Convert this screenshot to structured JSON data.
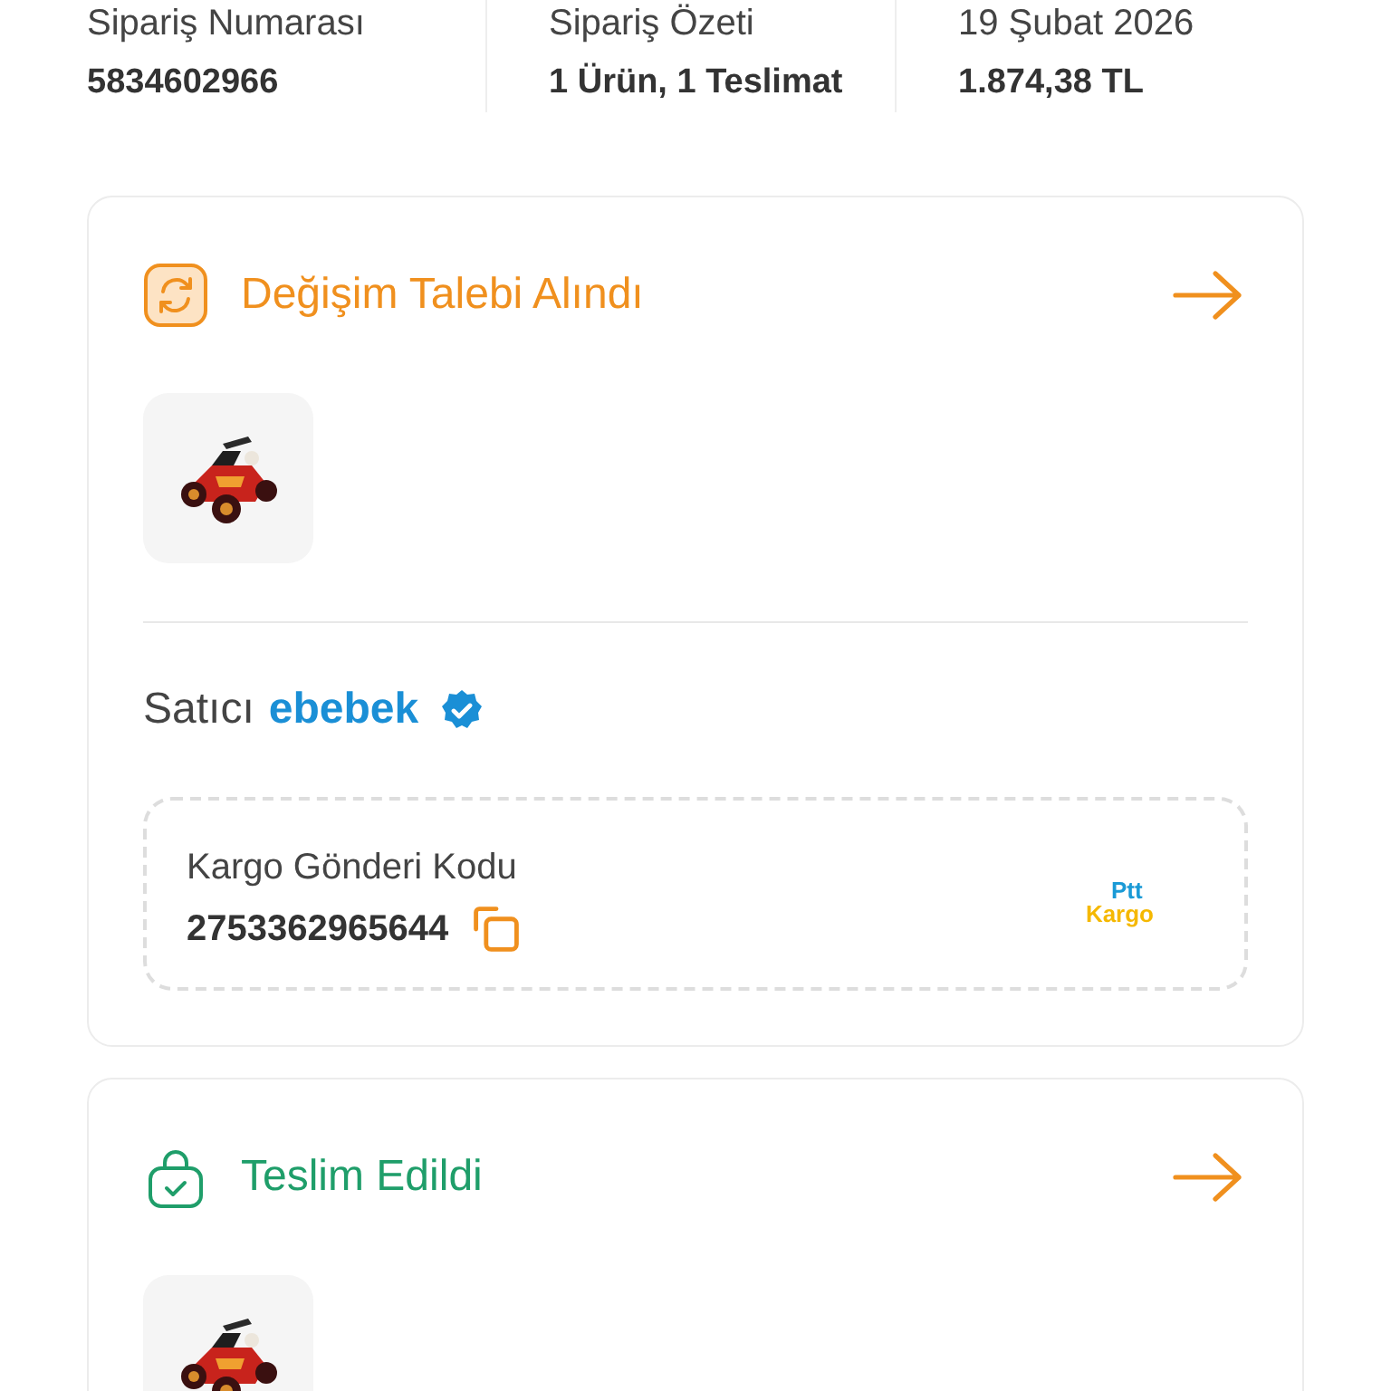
{
  "summary": [
    {
      "label": "Sipariş Numarası",
      "value": "5834602966"
    },
    {
      "label": "Sipariş Özeti",
      "value": "1 Ürün, 1 Teslimat"
    },
    {
      "label": "19 Şubat 2026",
      "value": "1.874,38 TL"
    }
  ],
  "shipments": [
    {
      "kind": "exchange",
      "status": "Değişim Talebi Alındı",
      "seller": {
        "label": "Satıcı",
        "name": "ebebek",
        "verified": true
      },
      "cargo": {
        "label": "Kargo Gönderi Kodu",
        "code": "2753362965644",
        "carrier_line1": "Ptt",
        "carrier_line2": "Kargo"
      }
    },
    {
      "kind": "delivered",
      "status": "Teslim Edildi"
    }
  ]
}
